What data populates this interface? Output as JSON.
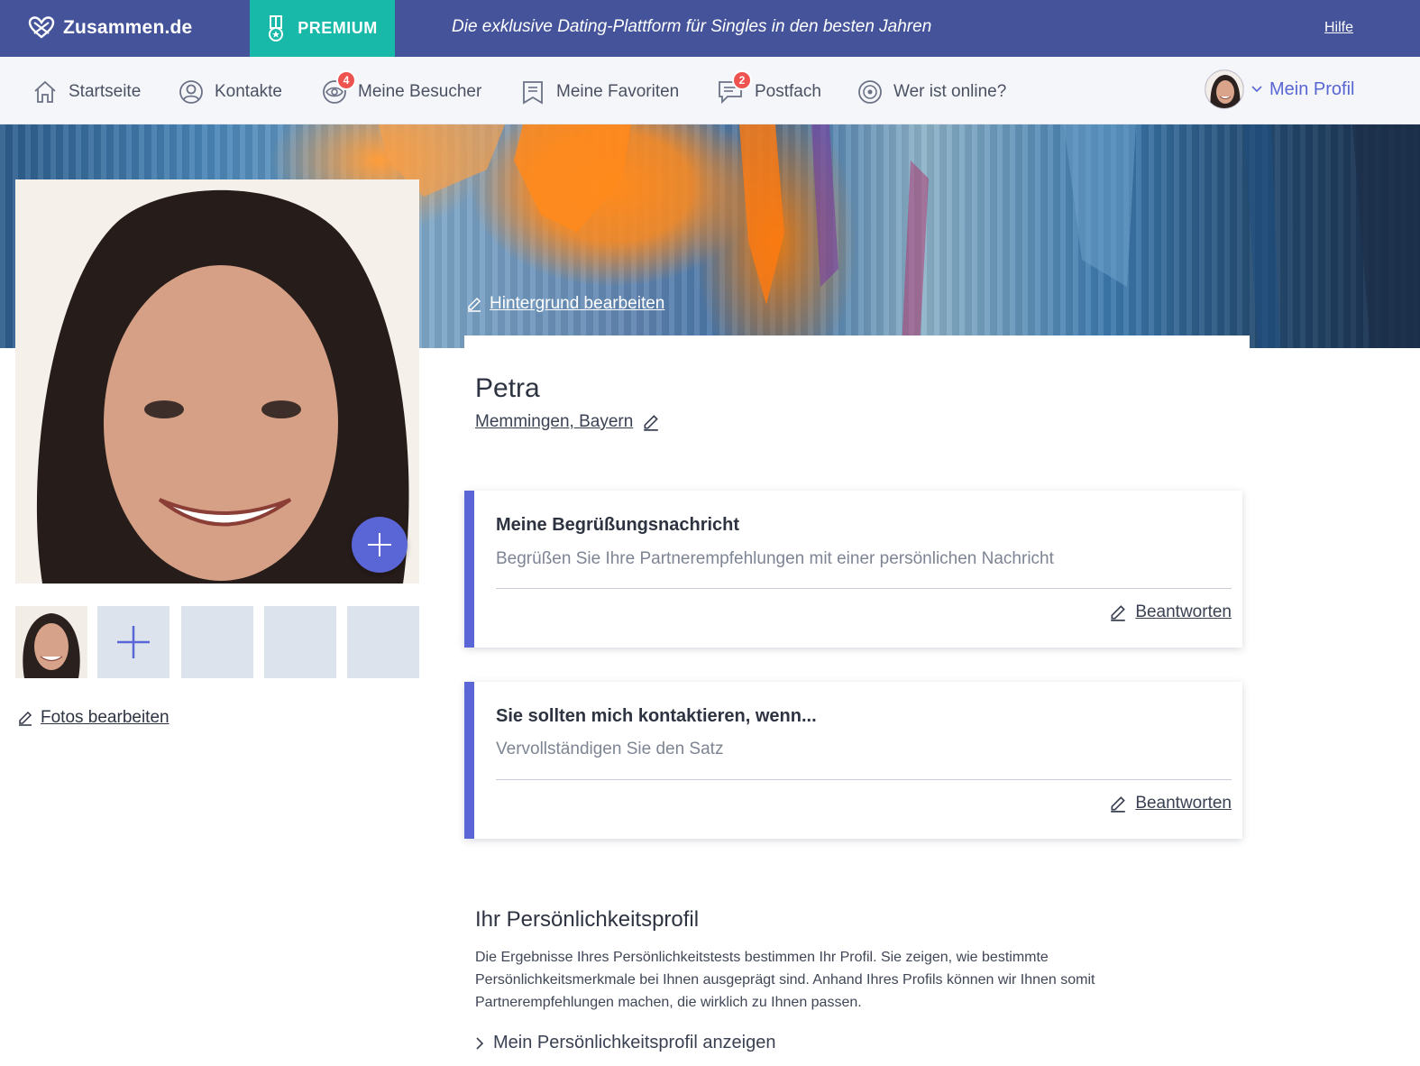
{
  "topbar": {
    "brand": "Zusammen.de",
    "premium_label": "PREMIUM",
    "tagline": "Die exklusive Dating-Plattform für Singles in den besten Jahren",
    "help_label": "Hilfe"
  },
  "nav": {
    "items": [
      {
        "label": "Startseite",
        "icon": "home-icon"
      },
      {
        "label": "Kontakte",
        "icon": "user-icon"
      },
      {
        "label": "Meine Besucher",
        "icon": "eye-icon",
        "badge": "4"
      },
      {
        "label": "Meine Favoriten",
        "icon": "bookmark-icon"
      },
      {
        "label": "Postfach",
        "icon": "message-icon",
        "badge": "2"
      },
      {
        "label": "Wer ist online?",
        "icon": "online-icon"
      }
    ],
    "profile_label": "Mein Profil"
  },
  "banner": {
    "edit_label": "Hintergrund bearbeiten"
  },
  "photos": {
    "edit_label": "Fotos bearbeiten"
  },
  "profile": {
    "name": "Petra",
    "location": "Memmingen, Bayern"
  },
  "cards": [
    {
      "title": "Meine Begrüßungsnachricht",
      "subtitle": "Begrüßen Sie Ihre Partnerempfehlungen mit einer persönlichen Nachricht",
      "action": "Beantworten"
    },
    {
      "title": "Sie sollten mich kontaktieren, wenn...",
      "subtitle": "Vervollständigen Sie den Satz",
      "action": "Beantworten"
    }
  ],
  "personality": {
    "title": "Ihr Persönlichkeitsprofil",
    "text": "Die Ergebnisse Ihres Persönlichkeitstests bestimmen Ihr Profil. Sie zeigen, wie bestimmte Persönlichkeitsmerkmale bei Ihnen ausgeprägt sind. Anhand Ihres Profils können wir Ihnen somit Partnerempfehlungen machen, die wirklich zu Ihnen passen.",
    "link": "Mein Persönlichkeitsprofil anzeigen"
  },
  "colors": {
    "topbar": "#45549a",
    "premium": "#18b9a8",
    "accent": "#5a66d6",
    "badge": "#ef5350"
  }
}
